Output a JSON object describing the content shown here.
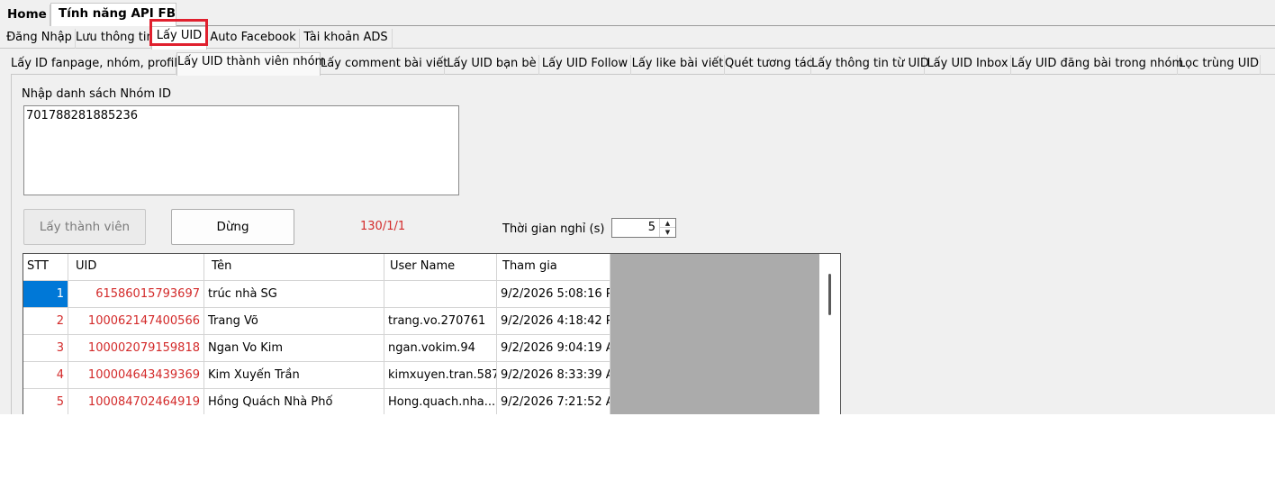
{
  "top_tabs": {
    "home": "Home",
    "api": "Tính năng API FB"
  },
  "sub_tabs": [
    "Đăng Nhập",
    "Lưu thông tin",
    "Lấy UID",
    "Auto Facebook",
    "Tài khoản ADS"
  ],
  "inner_tabs": [
    "Lấy ID fanpage, nhóm, profile",
    "Lấy UID thành viên nhóm",
    "Lấy comment bài viết",
    "Lấy UID bạn bè",
    "Lấy UID Follow",
    "Lấy like bài viết",
    "Quét tương tác",
    "Lấy thông tin từ UID",
    "Lấy UID Inbox",
    "Lấy UID đăng bài trong nhóm",
    "Lọc trùng UID"
  ],
  "form": {
    "group_label": "Nhập danh sách Nhóm ID",
    "group_value": "701788281885236",
    "get_members_button": "Lấy thành viên",
    "stop_button": "Dừng",
    "progress": "130/1/1",
    "sleep_label": "Thời gian nghỉ (s)",
    "sleep_value": "5"
  },
  "table": {
    "headers": [
      "STT",
      "UID",
      "Tên",
      "User Name",
      "Tham gia"
    ],
    "rows": [
      [
        "1",
        "61586015793697",
        "trúc nhà SG",
        "",
        "9/2/2026 5:08:16 PM"
      ],
      [
        "2",
        "100062147400566",
        "Trang Võ",
        "trang.vo.270761",
        "9/2/2026 4:18:42 PM"
      ],
      [
        "3",
        "100002079159818",
        "Ngan Vo Kim",
        "ngan.vokim.94",
        "9/2/2026 9:04:19 AM"
      ],
      [
        "4",
        "100004643439369",
        "Kim Xuyến Trần",
        "kimxuyen.tran.587",
        "9/2/2026 8:33:39 AM"
      ],
      [
        "5",
        "100084702464919",
        "Hồng Quách Nhà Phố",
        "Hong.quach.nha....",
        "9/2/2026 7:21:52 AM"
      ]
    ]
  },
  "colors": {
    "highlight": "#e0202e",
    "uid_text": "#d32a2a",
    "selection": "#0078d7"
  }
}
